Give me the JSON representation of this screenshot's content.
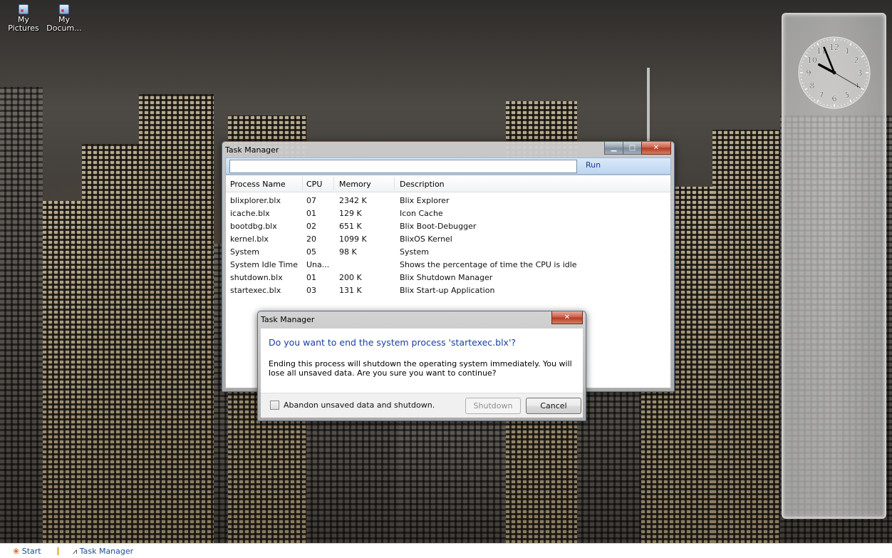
{
  "desktop": {
    "icons": [
      {
        "label_line1": "My",
        "label_line2": "Pictures"
      },
      {
        "label_line1": "My",
        "label_line2": "Docum..."
      }
    ]
  },
  "clock": {
    "numbers": [
      "12",
      "1",
      "2",
      "3",
      "4",
      "5",
      "6",
      "7",
      "8",
      "9",
      "10",
      "11"
    ],
    "time": {
      "hour": 9,
      "minute": 56,
      "second": 20
    }
  },
  "task_manager": {
    "title": "Task Manager",
    "run_label": "Run",
    "command_value": "",
    "columns": [
      "Process Name",
      "CPU",
      "Memory",
      "Description"
    ],
    "rows": [
      {
        "name": "blixplorer.blx",
        "cpu": "07",
        "memory": "2342 K",
        "description": "Blix Explorer"
      },
      {
        "name": "icache.blx",
        "cpu": "01",
        "memory": "129 K",
        "description": "Icon Cache"
      },
      {
        "name": "bootdbg.blx",
        "cpu": "02",
        "memory": "651 K",
        "description": "Blix Boot-Debugger"
      },
      {
        "name": "kernel.blx",
        "cpu": "20",
        "memory": "1099 K",
        "description": "BlixOS Kernel"
      },
      {
        "name": "System",
        "cpu": "05",
        "memory": "98 K",
        "description": "System"
      },
      {
        "name": "System Idle Time",
        "cpu": "Una...",
        "memory": "",
        "description": "Shows the percentage of time the CPU is idle"
      },
      {
        "name": "shutdown.blx",
        "cpu": "01",
        "memory": "200 K",
        "description": "Blix Shutdown Manager"
      },
      {
        "name": "startexec.blx",
        "cpu": "03",
        "memory": "131 K",
        "description": "Blix Start-up Application"
      }
    ]
  },
  "dialog": {
    "title": "Task Manager",
    "instruction": "Do you want to end the system process 'startexec.blx'?",
    "message_line1": "Ending this process will shutdown the operating system immediately. You will",
    "message_line2": "lose all unsaved data. Are you sure you want to continue?",
    "checkbox_label": "Abandon unsaved data and shutdown.",
    "checkbox_checked": false,
    "shutdown_label": "Shutdown",
    "cancel_label": "Cancel"
  },
  "taskbar": {
    "start_label": "Start",
    "task_label": "Task Manager"
  }
}
